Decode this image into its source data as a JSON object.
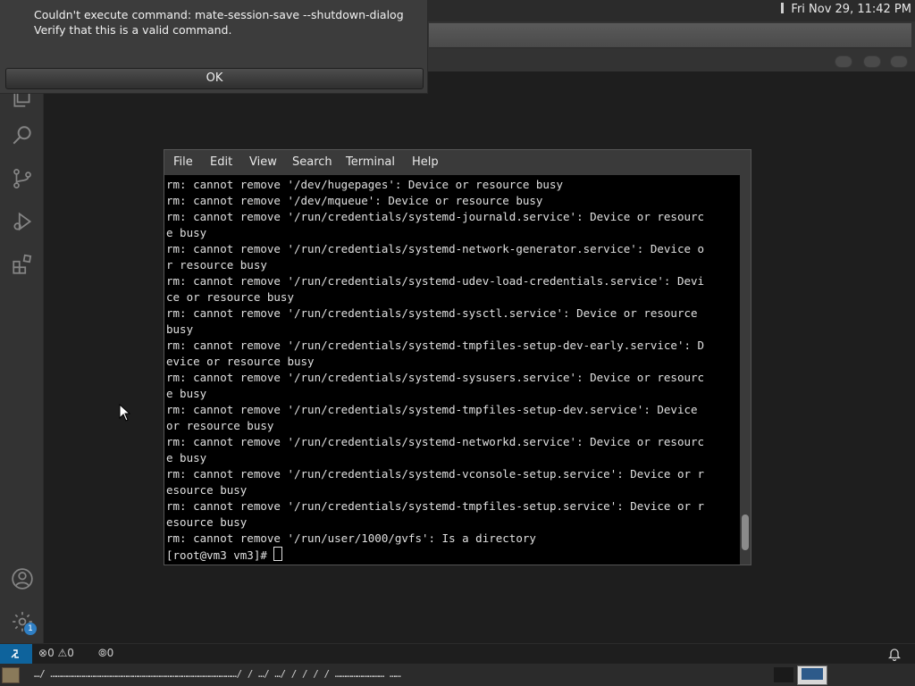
{
  "clock": {
    "text": "Fri Nov 29, 11:42 PM"
  },
  "dialog": {
    "message_line1": "Couldn't execute command: mate-session-save --shutdown-dialog",
    "message_line2": "Verify that this is a valid command.",
    "ok_label": "OK"
  },
  "terminal": {
    "menu": [
      "File",
      "Edit",
      "View",
      "Search",
      "Terminal",
      "Help"
    ],
    "lines": [
      "rm: cannot remove '/dev/hugepages': Device or resource busy",
      "rm: cannot remove '/dev/mqueue': Device or resource busy",
      "rm: cannot remove '/run/credentials/systemd-journald.service': Device or resourc",
      "e busy",
      "rm: cannot remove '/run/credentials/systemd-network-generator.service': Device o",
      "r resource busy",
      "rm: cannot remove '/run/credentials/systemd-udev-load-credentials.service': Devi",
      "ce or resource busy",
      "rm: cannot remove '/run/credentials/systemd-sysctl.service': Device or resource ",
      "busy",
      "rm: cannot remove '/run/credentials/systemd-tmpfiles-setup-dev-early.service': D",
      "evice or resource busy",
      "rm: cannot remove '/run/credentials/systemd-sysusers.service': Device or resourc",
      "e busy",
      "rm: cannot remove '/run/credentials/systemd-tmpfiles-setup-dev.service': Device ",
      "or resource busy",
      "rm: cannot remove '/run/credentials/systemd-networkd.service': Device or resourc",
      "e busy",
      "rm: cannot remove '/run/credentials/systemd-vconsole-setup.service': Device or r",
      "esource busy",
      "rm: cannot remove '/run/credentials/systemd-tmpfiles-setup.service': Device or r",
      "esource busy",
      "rm: cannot remove '/run/user/1000/gvfs': Is a directory"
    ],
    "prompt": "[root@vm3 vm3]# "
  },
  "status_bar": {
    "errors": "0",
    "warnings": "0",
    "ports": "0"
  },
  "activity_bar": {
    "settings_badge": "1"
  },
  "bottom_panel": {
    "tasks_text": "…/ …………………………………………………………………………………………/ / …/ …/ / / / / ……………………… ……"
  },
  "colors": {
    "editor_bg": "#1e1e1e",
    "activity_bar_bg": "#333333",
    "remote_button": "#0e639c",
    "badge": "#2f7fc4"
  }
}
